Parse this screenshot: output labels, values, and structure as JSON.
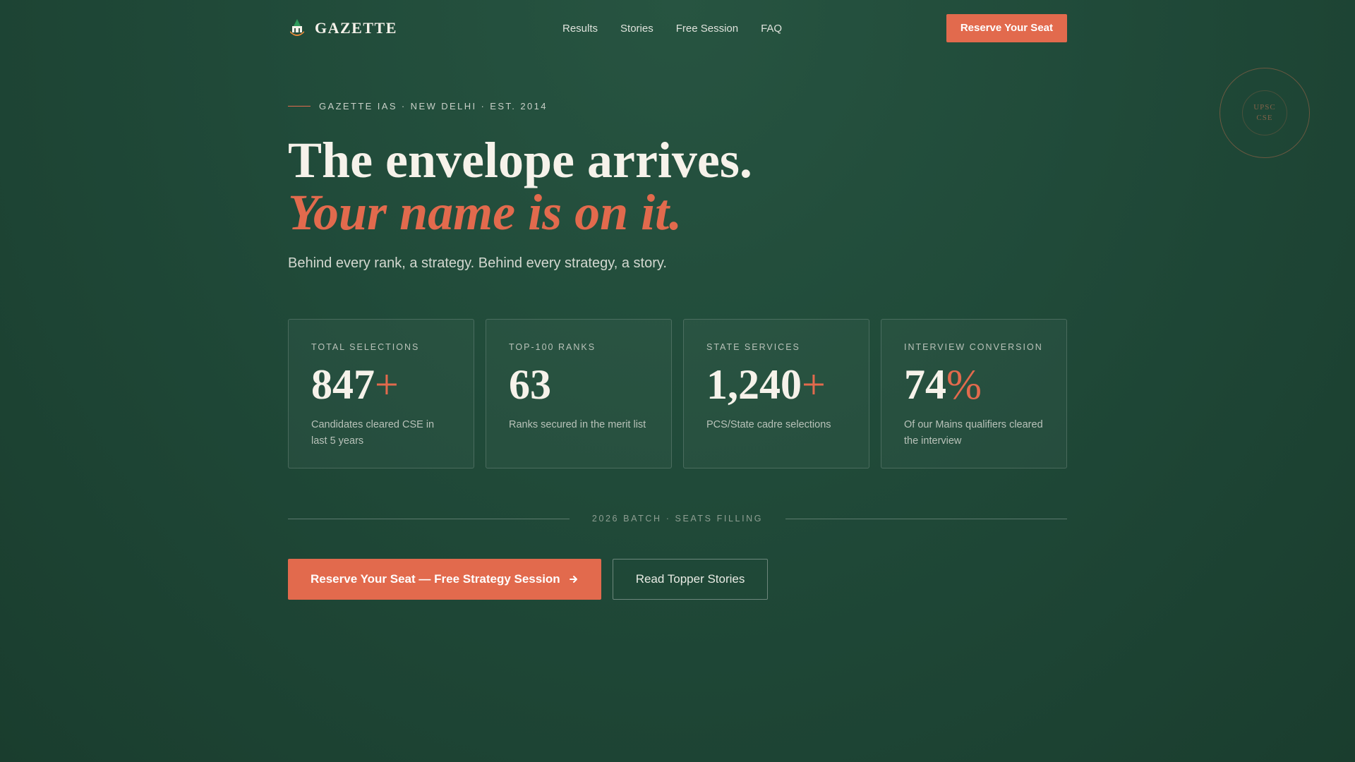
{
  "nav": {
    "brand": "GAZETTE",
    "links": [
      "Results",
      "Stories",
      "Free Session",
      "FAQ"
    ],
    "cta": "Reserve Your Seat"
  },
  "stamp": {
    "line1": "UPSC",
    "line2": "CSE"
  },
  "hero": {
    "eyebrow": "GAZETTE IAS · NEW DELHI · EST. 2014",
    "headline_line1": "The envelope arrives.",
    "headline_line2": "Your name is on it.",
    "subtitle": "Behind every rank, a strategy. Behind every strategy, a story."
  },
  "stats": [
    {
      "label": "TOTAL SELECTIONS",
      "value": "847",
      "suffix": "+",
      "desc": "Candidates cleared CSE in last 5 years"
    },
    {
      "label": "TOP-100 RANKS",
      "value": "63",
      "suffix": "",
      "desc": "Ranks secured in the merit list"
    },
    {
      "label": "STATE SERVICES",
      "value": "1,240",
      "suffix": "+",
      "desc": "PCS/State cadre selections"
    },
    {
      "label": "INTERVIEW CONVERSION",
      "value": "74",
      "suffix": "%",
      "desc": "Of our Mains qualifiers cleared the interview"
    }
  ],
  "divider": "2026 BATCH · SEATS FILLING",
  "ctas": {
    "primary": "Reserve Your Seat — Free Strategy Session",
    "primary_icon": "arrow-right-icon",
    "secondary": "Read Topper Stories"
  },
  "colors": {
    "accent": "#e26a4d",
    "background": "#204a39",
    "text": "#f6f2ea"
  }
}
